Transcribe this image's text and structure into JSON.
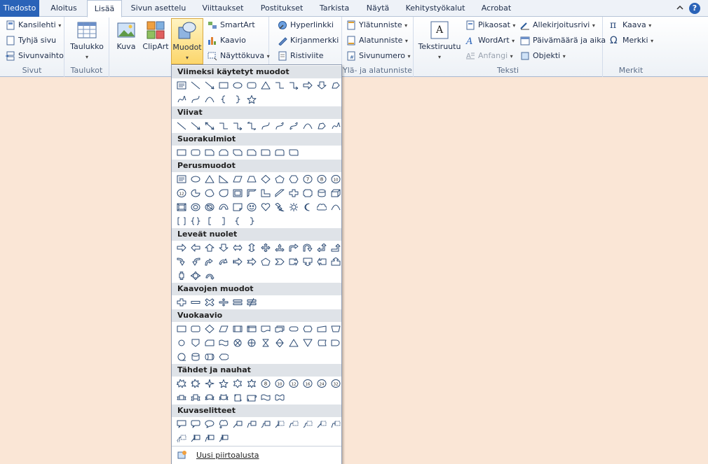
{
  "tabs": [
    "Tiedosto",
    "Aloitus",
    "Lisää",
    "Sivun asettelu",
    "Viittaukset",
    "Postitukset",
    "Tarkista",
    "Näytä",
    "Kehitystyökalut",
    "Acrobat"
  ],
  "topright": {
    "collapse_icon": "chevron-up-icon",
    "help_icon": "help-icon",
    "help_glyph": "?"
  },
  "groups": {
    "sivut": {
      "label": "Sivut",
      "items": [
        "Kansilehti",
        "Tyhjä sivu",
        "Sivunvaihto"
      ]
    },
    "taulukot": {
      "label": "Taulukot",
      "button": "Taulukko"
    },
    "kuvitus": {
      "kuva": "Kuva",
      "clipart": "ClipArt",
      "muodot": "Muodot",
      "smartart": "SmartArt",
      "kaavio": "Kaavio",
      "nayttokuva": "Näyttökuva"
    },
    "linkit": {
      "items": [
        "Hyperlinkki",
        "Kirjanmerkki",
        "Ristiviite"
      ]
    },
    "yla": {
      "label": "Ylä- ja alatunniste",
      "items": [
        "Ylätunniste",
        "Alatunniste",
        "Sivunumero"
      ]
    },
    "teksti": {
      "label": "Teksti",
      "tekstiruutu": "Tekstiruutu",
      "items": [
        "Pikaosat",
        "WordArt",
        "Anfangi",
        "Allekirjoitusrivi",
        "Päivämäärä ja aika",
        "Objekti"
      ]
    },
    "merkit": {
      "label": "Merkit",
      "items": [
        "Kaava",
        "Merkki"
      ],
      "kaava_glyph": "π",
      "merkki_glyph": "Ω"
    }
  },
  "panel": {
    "sections": [
      {
        "title": "Viimeksi käytetyt muodot",
        "rows": [
          [
            "textbox",
            "line",
            "arrow",
            "rect",
            "oval",
            "roundrect",
            "triangle",
            "elbow",
            "elbowarrow",
            "rightarrow",
            "downarrow",
            "freeform"
          ],
          [
            "scribble",
            "curve",
            "arc",
            "lbrace",
            "rbrace",
            "star5"
          ]
        ]
      },
      {
        "title": "Viivat",
        "rows": [
          [
            "line",
            "arrow",
            "dblarrow",
            "elbow",
            "elbowarrow",
            "elbowdbl",
            "curve",
            "curvearrow",
            "curvedbl",
            "arc",
            "freeform",
            "scribble"
          ]
        ]
      },
      {
        "title": "Suorakulmiot",
        "rows": [
          [
            "rect",
            "roundrect",
            "snip1",
            "snip2",
            "snipdiag",
            "sniprnd",
            "rnd1",
            "rnd2",
            "rnddiag"
          ]
        ]
      },
      {
        "title": "Perusmuodot",
        "rows": [
          [
            "textbox",
            "oval",
            "triangle",
            "rtriangle",
            "parallelogram",
            "trapezoid",
            "diamond",
            "pentagon",
            "hexagon",
            "n7",
            "n8",
            "n10"
          ],
          [
            "n12",
            "pie",
            "chord",
            "teardrop",
            "frame",
            "halfframe",
            "lshape",
            "diagstripe",
            "plus",
            "plaque",
            "can",
            "cube"
          ],
          [
            "bevel",
            "donut",
            "nosign",
            "blockarc",
            "foldcorner",
            "smiley",
            "heart",
            "lightning",
            "sun",
            "moon",
            "cloud",
            "arc"
          ],
          [
            "dblbracket",
            "dblbrace",
            "lbracket",
            "rbracket",
            "lbrace",
            "rbrace"
          ]
        ]
      },
      {
        "title": "Leveät nuolet",
        "rows": [
          [
            "rightarrow",
            "leftarrow",
            "uparrow",
            "downarrow",
            "lrarrow",
            "udarrow",
            "quad",
            "lrup",
            "bent",
            "uturn",
            "leftup",
            "bentup"
          ],
          [
            "curvright",
            "curvleft",
            "curvup",
            "curvdown",
            "striped",
            "notched",
            "pentagon",
            "chevron",
            "rcallout",
            "dcallout",
            "lcallout",
            "ucallout"
          ],
          [
            "udcallout",
            "quadcallout",
            "circular"
          ]
        ]
      },
      {
        "title": "Kaavojen muodot",
        "rows": [
          [
            "plus",
            "minus",
            "multiply",
            "divide",
            "equal",
            "notequal"
          ]
        ]
      },
      {
        "title": "Vuokaavio",
        "rows": [
          [
            "rect",
            "alt",
            "diamond",
            "parallelogram",
            "predefined",
            "internal",
            "document",
            "multidoc",
            "terminator",
            "preparation",
            "manual",
            "manualop"
          ],
          [
            "connector",
            "offpage",
            "card",
            "tape",
            "sumjunc",
            "or",
            "collate",
            "sort",
            "extract",
            "merge",
            "stored",
            "delay"
          ],
          [
            "seqaccess",
            "disk",
            "direct",
            "display"
          ]
        ]
      },
      {
        "title": "Tähdet ja nauhat",
        "rows": [
          [
            "exp1",
            "exp2",
            "star4",
            "star5",
            "star6",
            "star7",
            "n8",
            "n10",
            "n12",
            "n16",
            "n24",
            "n32"
          ],
          [
            "ribbon1",
            "ribbon2",
            "ribcurve1",
            "ribcurve2",
            "scrollv",
            "scrollh",
            "wave",
            "dblwave"
          ]
        ]
      },
      {
        "title": "Kuvaselitteet",
        "rows": [
          [
            "rcall",
            "rrcall",
            "ocall",
            "cloudcall",
            "line1",
            "line2",
            "line3",
            "line1a",
            "line2a",
            "line3a",
            "line1b",
            "line2b"
          ],
          [
            "line3b",
            "line1c",
            "line2c",
            "line3c"
          ]
        ]
      }
    ],
    "footer": "Uusi piirtoalusta"
  }
}
